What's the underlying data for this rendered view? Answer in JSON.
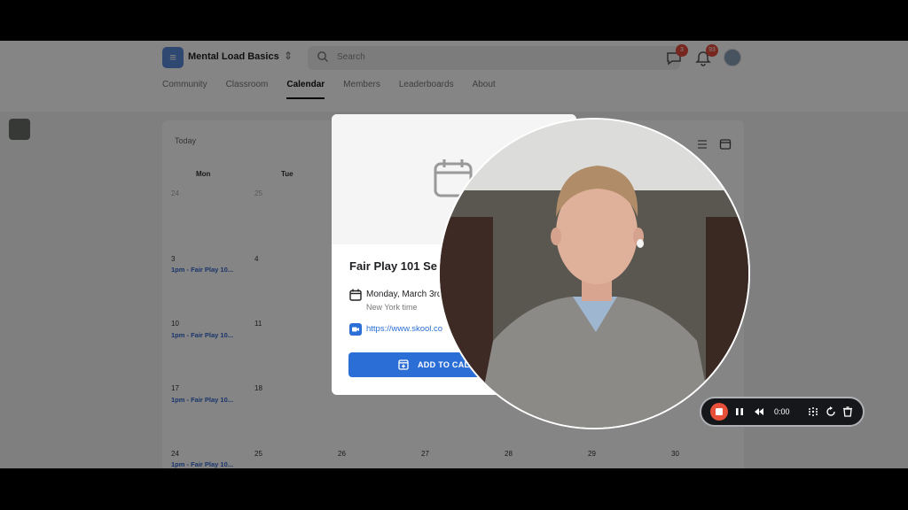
{
  "header": {
    "group_name": "Mental Load Basics",
    "search_placeholder": "Search",
    "chat_badge": "3",
    "notif_badge": "93"
  },
  "nav": {
    "tabs": [
      {
        "label": "Community",
        "active": false
      },
      {
        "label": "Classroom",
        "active": false
      },
      {
        "label": "Calendar",
        "active": true
      },
      {
        "label": "Members",
        "active": false
      },
      {
        "label": "Leaderboards",
        "active": false
      },
      {
        "label": "About",
        "active": false
      }
    ]
  },
  "calendar": {
    "today_label": "Today",
    "weekday_headers": [
      "Mon",
      "Tue"
    ],
    "days": [
      "24",
      "25",
      "3",
      "4",
      "10",
      "11",
      "17",
      "18",
      "24",
      "25",
      "26",
      "27",
      "28",
      "29",
      "30"
    ],
    "event_label": "1pm - Fair Play 10..."
  },
  "event_modal": {
    "title": "Fair Play 101 Se",
    "date": "Monday, March 3rd",
    "timezone": "New York time",
    "link": "https://www.skool.co",
    "add_button": "ADD TO CALE"
  },
  "recorder": {
    "time": "0:00"
  },
  "colors": {
    "accent": "#2b6fd6",
    "badge": "#e54b3c",
    "record": "#e8503a"
  }
}
